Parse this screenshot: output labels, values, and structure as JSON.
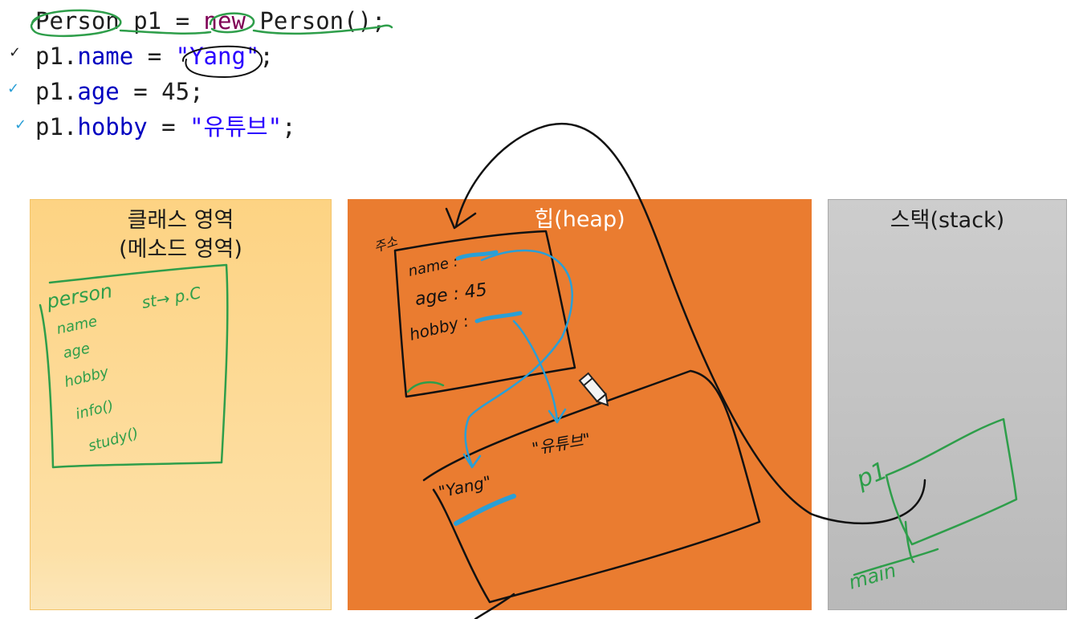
{
  "code": {
    "lines": [
      {
        "obj": "Person",
        "text1": " p1 = ",
        "kw": "new",
        "text2": " Person();",
        "tick": ""
      },
      {
        "obj": "p1.",
        "field": "name",
        "text1": " = ",
        "str": "\"Yang\"",
        "text2": ";",
        "tick": "✓"
      },
      {
        "obj": "p1.",
        "field": "age",
        "text1": " = 45;",
        "tick": "✓"
      },
      {
        "obj": "p1.",
        "field": "hobby",
        "text1": " = ",
        "str": "\"유튜브\"",
        "text2": ";",
        "tick": "✓"
      }
    ]
  },
  "panels": {
    "class_area": {
      "title": "클래스 영역",
      "subtitle": "(메소드 영역)"
    },
    "heap": {
      "title": "힙(heap)"
    },
    "stack": {
      "title": "스택(stack)"
    }
  },
  "annotations": {
    "class_box": {
      "name": "person",
      "static": "st→ p.C",
      "members": [
        "name",
        "age",
        "hobby",
        "info()",
        "study()"
      ]
    },
    "heap_object": {
      "label": "주소",
      "fields": [
        "name :",
        "age : 45",
        "hobby :"
      ]
    },
    "string_pool": {
      "values": [
        "\"Yang\"",
        "\"유튜브\""
      ]
    },
    "stack_frame": {
      "variable": "p1",
      "frame": "main"
    }
  },
  "colors": {
    "class_panel": "#fdd383",
    "heap_panel": "#ea7c30",
    "stack_panel": "#c4c4c4",
    "ink_black": "#111111",
    "ink_green": "#2e9e4a",
    "ink_blue": "#2a9fd6"
  },
  "icons": [
    "check-icon",
    "pencil-cursor-icon"
  ]
}
